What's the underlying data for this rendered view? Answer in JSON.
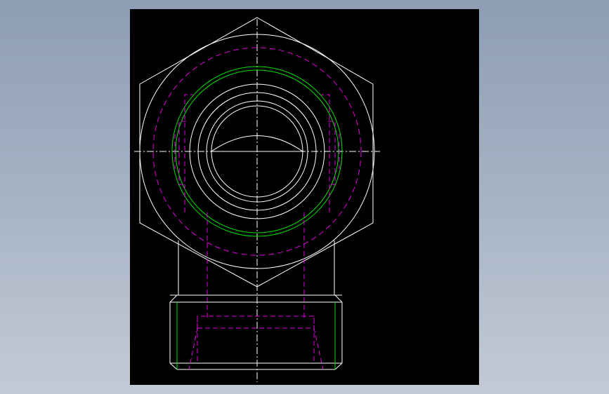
{
  "viewport": {
    "background": "#000000",
    "colors": {
      "visible_edges": "#ffffff",
      "hidden_lines": "#e000e0",
      "thread_lines": "#00e000",
      "center_lines": "#ffffff"
    },
    "view_content": "cad-drawing-hex-fitting-top-view-and-side-view"
  }
}
